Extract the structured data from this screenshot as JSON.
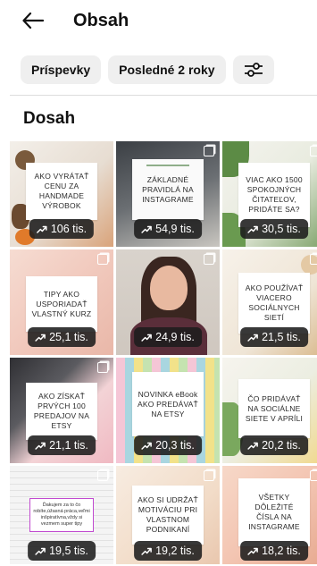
{
  "header": {
    "title": "Obsah"
  },
  "filters": {
    "posts": "Príspevky",
    "period": "Posledné 2 roky"
  },
  "section": {
    "title": "Dosah"
  },
  "colors": {
    "accent_green": "#8fae8a",
    "chip_bg": "#efefef",
    "badge_bg": "#1c1c1c"
  },
  "tiles": [
    {
      "text": "AKO VYRÁTAŤ CENU ZA HANDMADE VÝROBOK",
      "views": "106 tis."
    },
    {
      "text": "ZÁKLADNÉ PRAVIDLÁ NA INSTAGRAME",
      "views": "54,9 tis."
    },
    {
      "text": "VIAC AKO 1500 SPOKOJNÝCH ČITATEĽOV, PRIDÁTE SA?",
      "views": "30,5 tis."
    },
    {
      "text": "TIPY AKO USPORIADAŤ VLASTNÝ KURZ",
      "views": "25,1 tis."
    },
    {
      "text": "",
      "views": "24,9 tis."
    },
    {
      "text": "AKO POUŽÍVAŤ VIACERO SOCIÁLNYCH SIETÍ",
      "views": "21,5 tis."
    },
    {
      "text": "AKO ZÍSKAŤ PRVÝCH 100 PREDAJOV NA ETSY",
      "views": "21,1 tis."
    },
    {
      "text": "NOVINKA eBook AKO PREDÁVAŤ NA ETSY",
      "views": "20,3 tis."
    },
    {
      "text": "ČO PRIDÁVAŤ NA SOCIÁLNE SIETE V APRÍLI",
      "views": "20,2 tis."
    },
    {
      "text": "Ďakujem za to čo robíte,úžasná práca,veľmi inšpiratívna,vždy si vezmem super tipy",
      "views": "19,5 tis."
    },
    {
      "text": "AKO SI UDRŽAŤ MOTIVÁCIU PRI VLASTNOM PODNIKANÍ",
      "views": "19,2 tis."
    },
    {
      "text": "VŠETKY DÔLEŽITÉ ČÍSLA NA INSTAGRAME",
      "views": "18,2 tis."
    }
  ]
}
